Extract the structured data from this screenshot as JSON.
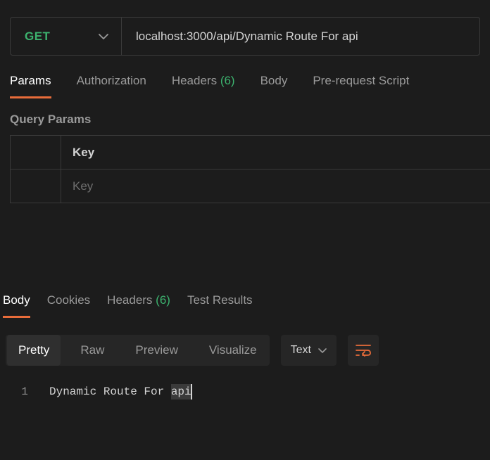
{
  "request": {
    "method": "GET",
    "url": "localhost:3000/api/Dynamic Route For api"
  },
  "tabs": {
    "params": "Params",
    "authorization": "Authorization",
    "headers_label": "Headers",
    "headers_count": "(6)",
    "body": "Body",
    "prerequest": "Pre-request Script"
  },
  "query": {
    "heading": "Query Params",
    "key_header": "Key",
    "key_placeholder": "Key"
  },
  "response_tabs": {
    "body": "Body",
    "cookies": "Cookies",
    "headers_label": "Headers",
    "headers_count": "(6)",
    "test_results": "Test Results"
  },
  "viewer": {
    "pretty": "Pretty",
    "raw": "Raw",
    "preview": "Preview",
    "visualize": "Visualize",
    "format": "Text"
  },
  "code": {
    "line_no": "1",
    "content_prefix": "Dynamic Route For ",
    "content_highlight": "api"
  }
}
